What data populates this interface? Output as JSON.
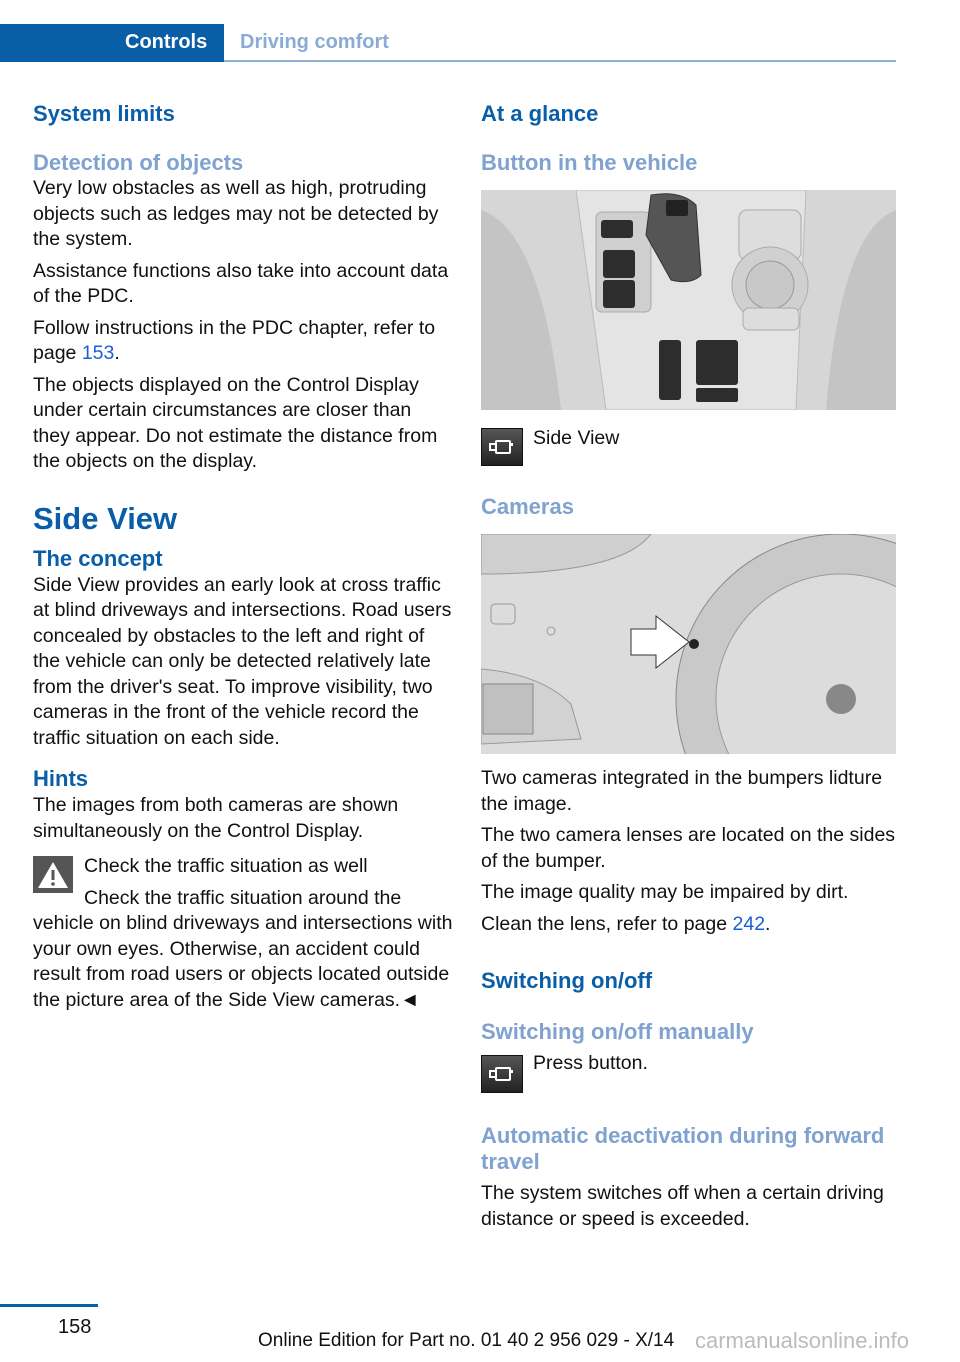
{
  "header": {
    "tab_active": "Controls",
    "tab_section": "Driving comfort"
  },
  "left": {
    "system_limits": "System limits",
    "detection_heading": "Detection of objects",
    "detection_p1": "Very low obstacles as well as high, protruding objects such as ledges may not be detected by the system.",
    "detection_p2": "Assistance functions also take into account data of the PDC.",
    "detection_p3_pre": "Follow instructions in the PDC chapter, refer to page ",
    "detection_p3_link": "153",
    "detection_p3_post": ".",
    "detection_p4": "The objects displayed on the Control Display under certain circumstances are closer than they appear. Do not estimate the distance from the objects on the display.",
    "side_view_title": "Side View",
    "concept_heading": "The concept",
    "concept_p": "Side View provides an early look at cross traffic at blind driveways and intersections. Road users concealed by obstacles to the left and right of the vehicle can only be detected relatively late from the driver's seat. To improve visibility, two cameras in the front of the vehicle record the traffic situation on each side.",
    "hints_heading": "Hints",
    "hints_p": "The images from both cameras are shown simultaneously on the Control Display.",
    "warning_title": "Check the traffic situation as well",
    "warning_text": "Check the traffic situation around the vehicle on blind driveways and intersections with your own eyes. Otherwise, an accident could result from road users or objects located outside the picture area of the Side View cameras.◄"
  },
  "right": {
    "at_a_glance": "At a glance",
    "button_heading": "Button in the vehicle",
    "button_label": "Side View",
    "cameras_heading": "Cameras",
    "cameras_p1": "Two cameras integrated in the bumpers lidture the image.",
    "cameras_p2": "The two camera lenses are located on the sides of the bumper.",
    "cameras_p3": "The image quality may be impaired by dirt.",
    "cameras_p4_pre": "Clean the lens, refer to page ",
    "cameras_p4_link": "242",
    "cameras_p4_post": ".",
    "switching_heading": "Switching on/off",
    "manual_heading": "Switching on/off manually",
    "press_button": "Press button.",
    "auto_heading": "Automatic deactivation during forward travel",
    "auto_p": "The system switches off when a certain driving distance or speed is exceeded."
  },
  "footer": {
    "page_number": "158",
    "edition": "Online Edition for Part no. 01 40 2 956 029 - X/14",
    "watermark": "carmanualsonline.info"
  }
}
